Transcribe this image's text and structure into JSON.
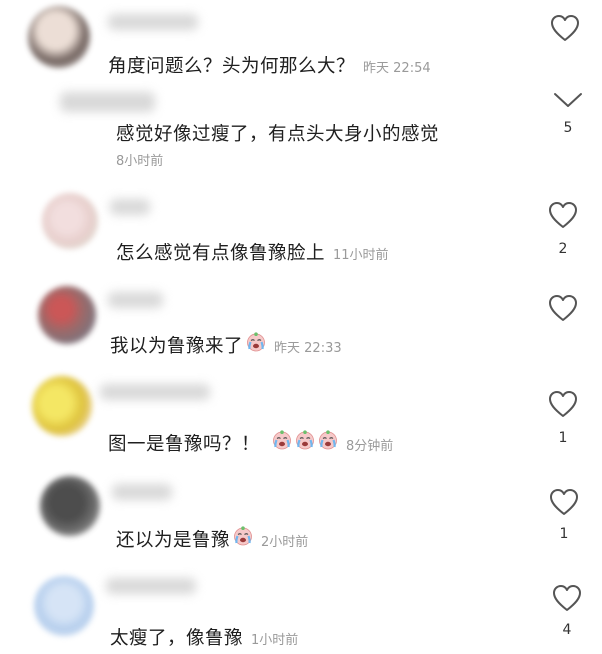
{
  "comments": [
    {
      "text": "角度问题么？头为何那么大？",
      "time": "昨天 22:54",
      "likes": ""
    },
    {
      "text": "感觉好像过瘦了，有点头大身小的感觉",
      "time": "8小时前",
      "likes": "5"
    },
    {
      "text": "怎么感觉有点像鲁豫脸上",
      "time": "11小时前",
      "likes": "2"
    },
    {
      "text": "我以为鲁豫来了",
      "time": "昨天 22:33",
      "likes": ""
    },
    {
      "text": "图一是鲁豫吗？！",
      "time": "8分钟前",
      "likes": "1"
    },
    {
      "text": "还以为是鲁豫",
      "time": "2小时前",
      "likes": "1"
    },
    {
      "text": "太瘦了，像鲁豫",
      "time": "1小时前",
      "likes": "4"
    }
  ],
  "icons": {
    "like": "heart-outline-icon",
    "collapse": "chevron-down-icon",
    "emoji": "crying-face-emoji"
  },
  "colors": {
    "text": "#1f1f1f",
    "time": "#9a9a9a",
    "icon": "#555555"
  }
}
